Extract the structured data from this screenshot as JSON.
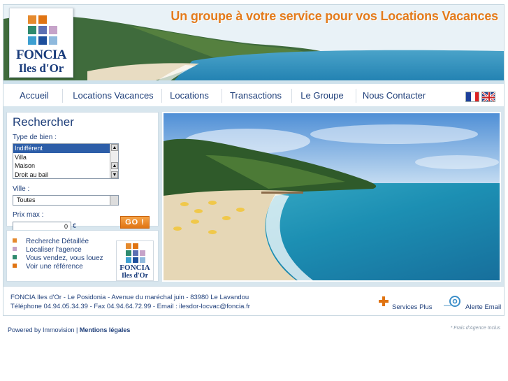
{
  "header": {
    "slogan": "Un groupe à votre service pour vos Locations Vacances",
    "logo": {
      "line1": "FONCIA",
      "line2": "Iles d'Or"
    }
  },
  "nav": {
    "items": [
      "Accueil",
      "Locations Vacances",
      "Locations",
      "Transactions",
      "Le Groupe",
      "Nous Contacter"
    ],
    "languages": [
      "fr-flag-icon",
      "uk-flag-icon"
    ]
  },
  "search": {
    "title": "Rechercher",
    "type_label": "Type de bien :",
    "type_options": [
      "Indifférent",
      "Villa",
      "Maison",
      "Droit au bail"
    ],
    "type_selected": "Indifférent",
    "city_label": "Ville :",
    "city_value": "Toutes",
    "price_label": "Prix max :",
    "price_value": "0",
    "currency": "€",
    "go_label": "GO !"
  },
  "links": {
    "items": [
      {
        "label": "Recherche Détaillée",
        "color": "#e58a2e"
      },
      {
        "label": "Localiser l'agence",
        "color": "#c6a3c9"
      },
      {
        "label": "Vous vendez, vous louez",
        "color": "#2e8a6e"
      },
      {
        "label": "Voir une référence",
        "color": "#e07412"
      }
    ],
    "mini_logo": {
      "line1": "FONCIA",
      "line2": "Iles d'Or"
    }
  },
  "footer": {
    "address_line1": "FONCIA Iles d'Or - Le Posidonia - Avenue du maréchal juin - 83980 Le Lavandou",
    "address_line2": "Téléphone 04.94.05.34.39 - Fax 04.94.64.72.99 - Email : ilesdor-locvac@foncia.fr",
    "services_label": "Services Plus",
    "alert_label": "Alerte Email"
  },
  "bottom": {
    "powered_by": "Powered by Immovision |",
    "legal_link": "Mentions légales",
    "fees_note": "* Frais d'Agence Inclus"
  },
  "colors": {
    "accent_orange": "#e37b1c",
    "nav_blue": "#1f3f7a",
    "logo_blue": "#173a7a"
  }
}
